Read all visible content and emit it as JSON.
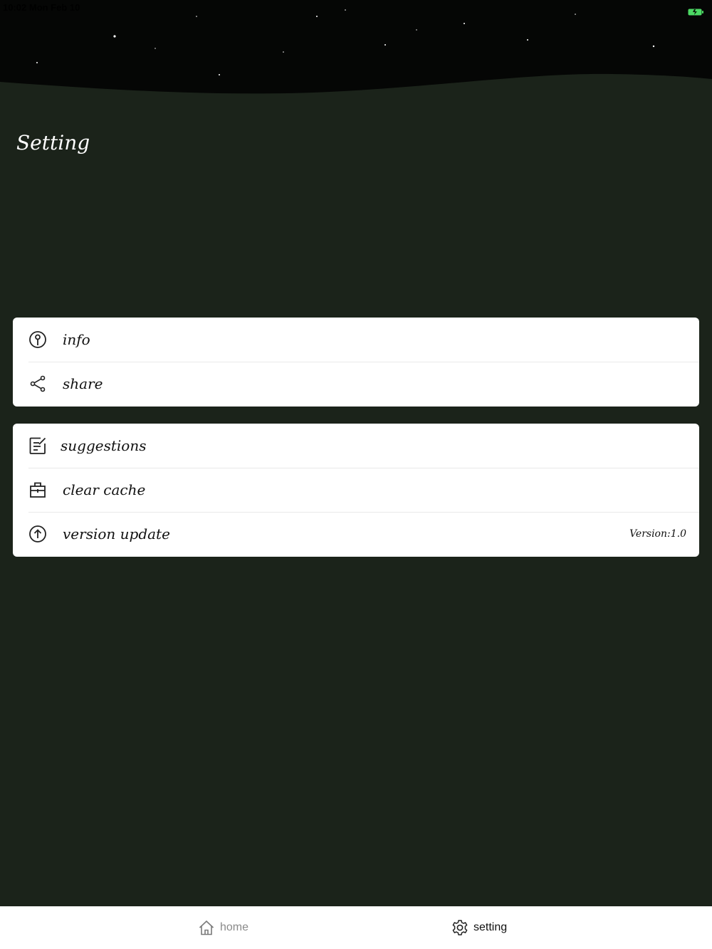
{
  "status_bar": {
    "time": "10:02 Mon Feb 10"
  },
  "header": {
    "title": "Setting"
  },
  "groups": [
    {
      "items": [
        {
          "label": "info",
          "icon": "info-icon"
        },
        {
          "label": "share",
          "icon": "share-icon"
        }
      ]
    },
    {
      "items": [
        {
          "label": "suggestions",
          "icon": "edit-note-icon"
        },
        {
          "label": "clear cache",
          "icon": "briefcase-icon"
        },
        {
          "label": "version update",
          "icon": "upload-circle-icon",
          "value": "Version:1.0"
        }
      ]
    }
  ],
  "tabbar": {
    "tabs": [
      {
        "label": "home",
        "icon": "home-icon",
        "active": false
      },
      {
        "label": "setting",
        "icon": "gear-icon",
        "active": true
      }
    ]
  },
  "colors": {
    "background": "#1b231a",
    "card": "#ffffff",
    "battery": "#4cd964"
  }
}
